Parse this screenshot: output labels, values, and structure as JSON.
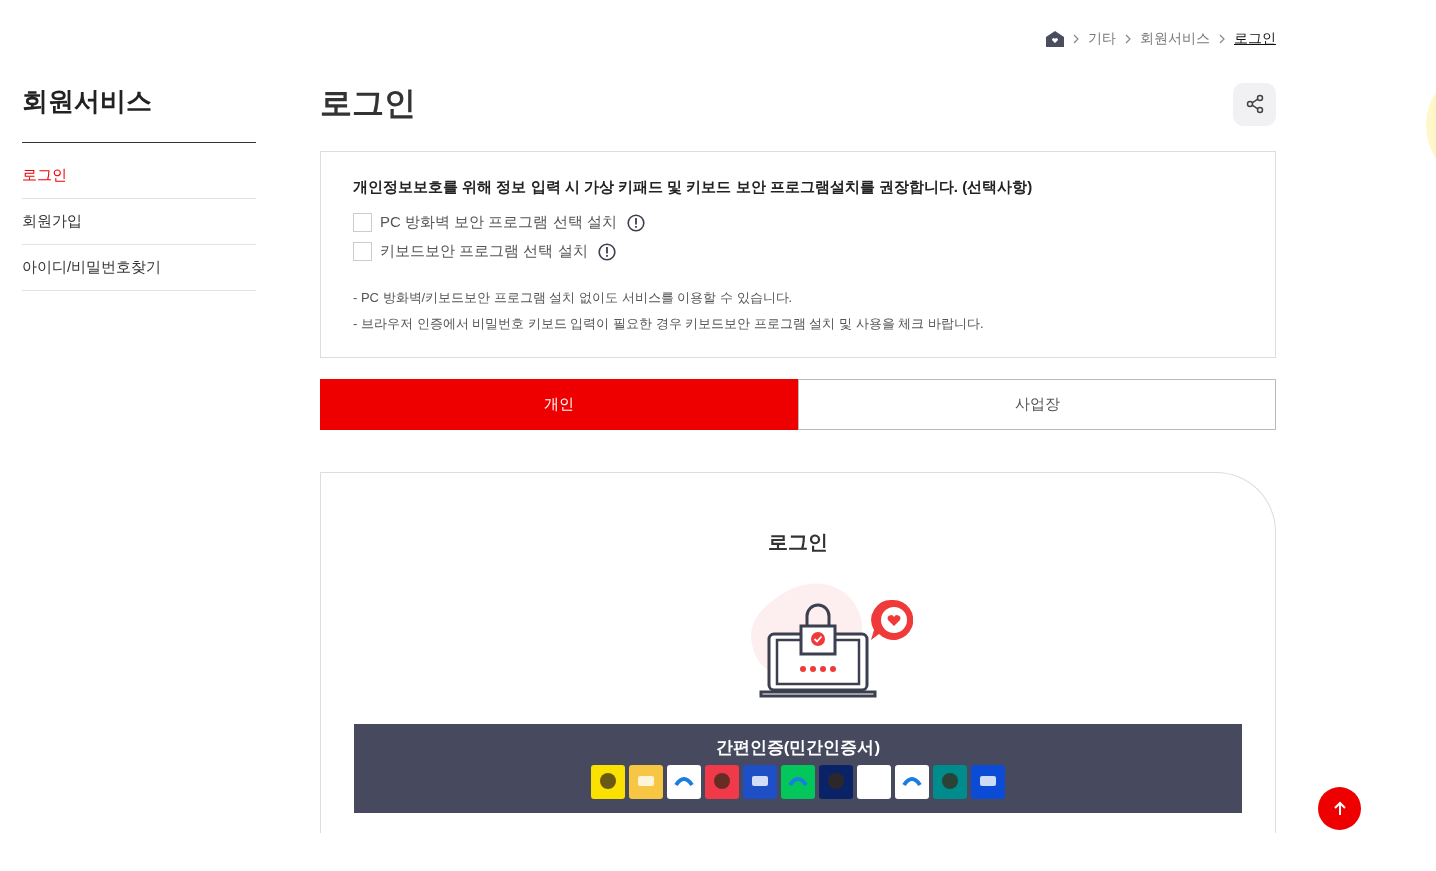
{
  "breadcrumb": [
    {
      "label": "기타",
      "current": false
    },
    {
      "label": "회원서비스",
      "current": false
    },
    {
      "label": "로그인",
      "current": true
    }
  ],
  "sidebar": {
    "title": "회원서비스",
    "items": [
      {
        "label": "로그인",
        "selected": true
      },
      {
        "label": "회원가입",
        "selected": false
      },
      {
        "label": "아이디/비밀번호찾기",
        "selected": false
      }
    ]
  },
  "page_title": "로그인",
  "notice": {
    "heading": "개인정보보호를 위해 정보 입력 시 가상 키패드 및 키보드 보안 프로그램설치를 권장합니다. (선택사항)",
    "options": [
      {
        "label": "PC 방화벽 보안 프로그램 선택 설치",
        "checked": false
      },
      {
        "label": "키보드보안 프로그램 선택 설치",
        "checked": false
      }
    ],
    "notes": [
      "-  PC 방화벽/키보드보안 프로그램 설치 없이도 서비스를 이용할 수 있습니다.",
      "-  브라우저 인증에서 비밀번호 키보드 입력이 필요한 경우 키보드보안 프로그램 설치 및 사용을 체크 바랍니다."
    ]
  },
  "tabs": [
    {
      "label": "개인",
      "selected": true
    },
    {
      "label": "사업장",
      "selected": false
    }
  ],
  "login_card": {
    "title": "로그인",
    "cert_panel": {
      "title": "간편인증(민간인증서)",
      "providers": [
        {
          "color": "#fae100"
        },
        {
          "color": "#f7c744"
        },
        {
          "color": "#ffffff"
        },
        {
          "color": "#f03a4a"
        },
        {
          "color": "#1e4fc7"
        },
        {
          "color": "#03c75a"
        },
        {
          "color": "#0a2366"
        },
        {
          "color": "#ffffff"
        },
        {
          "color": "#ffffff"
        },
        {
          "color": "#008c8c"
        },
        {
          "color": "#0b4bd6"
        }
      ]
    }
  }
}
